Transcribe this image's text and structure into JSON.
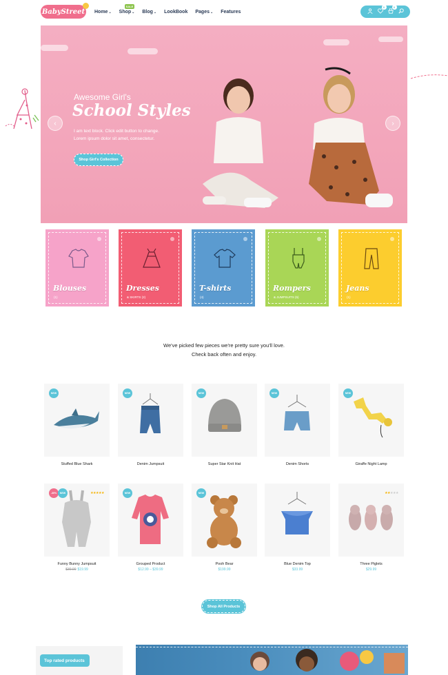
{
  "logo": "BabyStreet",
  "nav": [
    {
      "label": "Home",
      "dropdown": true
    },
    {
      "label": "Shop",
      "dropdown": true,
      "badge": "SALE"
    },
    {
      "label": "Blog",
      "dropdown": true
    },
    {
      "label": "LookBook",
      "dropdown": false
    },
    {
      "label": "Pages",
      "dropdown": true
    },
    {
      "label": "Features",
      "dropdown": false
    }
  ],
  "header_icons": {
    "wishlist_count": "0",
    "cart_count": "0"
  },
  "hero": {
    "subtitle": "Awesome Girl's",
    "title": "School Styles",
    "text_line1": "I am text block. Click edit button to change.",
    "text_line2": "Lorem ipsum dolor sit amet, consectetur.",
    "button": "Shop Girl's Collection"
  },
  "categories": [
    {
      "name": "Blouses",
      "count": "(1)",
      "color": "#f6a3c9"
    },
    {
      "name": "Dresses",
      "count": "& SKIRTS (2)",
      "color": "#f25d73"
    },
    {
      "name": "T-shirts",
      "count": "(4)",
      "color": "#5b9bd0"
    },
    {
      "name": "Rompers",
      "count": "& JUMPSUITS (5)",
      "color": "#a9d656"
    },
    {
      "name": "Jeans",
      "count": "(1)",
      "color": "#fccd2e"
    }
  ],
  "intro": {
    "line1": "We've picked few pieces we're pretty sure you'll love.",
    "line2": "Check back often and enjoy."
  },
  "products": [
    {
      "name": "Stuffed Blue Shark",
      "badge": "NEW",
      "price": "",
      "old_price": ""
    },
    {
      "name": "Denim Jumpsuit",
      "badge": "NEW",
      "price": "",
      "old_price": ""
    },
    {
      "name": "Super Star Knit Hat",
      "badge": "NEW",
      "price": "",
      "old_price": ""
    },
    {
      "name": "Denim Shorts",
      "badge": "NEW",
      "price": "",
      "old_price": ""
    },
    {
      "name": "Giraffe Night Lamp",
      "badge": "NEW",
      "price": "",
      "old_price": ""
    },
    {
      "name": "Funny Bunny Jumpsuit",
      "badge": "NEW",
      "sale_badge": "-30%",
      "rating": 5,
      "price": "$19.99",
      "old_price": "$30.00"
    },
    {
      "name": "Grouped Product",
      "badge": "NEW",
      "price": "$12.99 – $39.99",
      "old_price": ""
    },
    {
      "name": "Pooh Bear",
      "badge": "NEW",
      "price": "$199.99",
      "old_price": ""
    },
    {
      "name": "Blue Denim Top",
      "badge": "",
      "price": "$33.99",
      "old_price": ""
    },
    {
      "name": "Three Piglets",
      "badge": "",
      "rating": 2,
      "price": "$29.99",
      "old_price": ""
    }
  ],
  "view_all": "Shop All Products",
  "top_rated": "Top rated products"
}
